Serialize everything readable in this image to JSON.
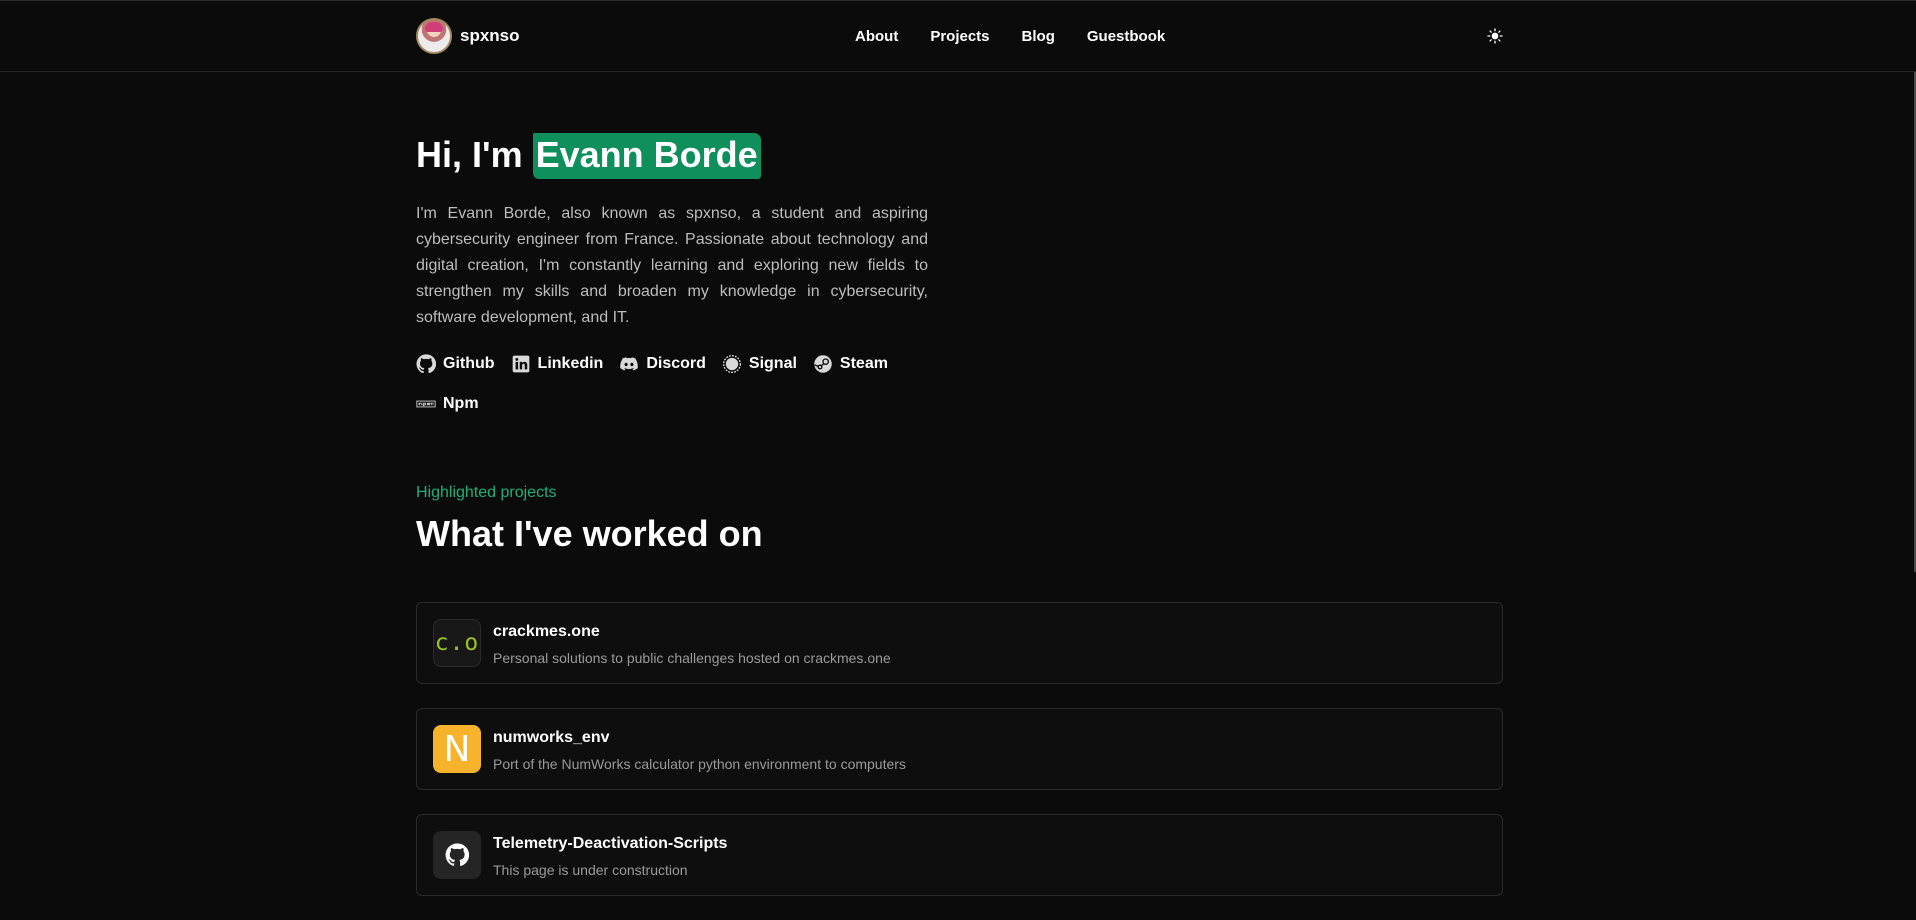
{
  "header": {
    "brand_name": "spxnso",
    "nav": [
      "About",
      "Projects",
      "Blog",
      "Guestbook"
    ],
    "theme_icon": "sun-icon"
  },
  "hero": {
    "greeting": "Hi, I'm",
    "name": "Evann Borde",
    "intro": "I'm Evann Borde, also known as spxnso, a student and aspiring cybersecurity engineer from France. Passionate about technology and digital creation, I'm constantly learning and exploring new fields to strengthen my skills and broaden my knowledge in cybersecurity, software development, and IT."
  },
  "socials": [
    {
      "label": "Github",
      "icon": "github-icon"
    },
    {
      "label": "Linkedin",
      "icon": "linkedin-icon"
    },
    {
      "label": "Discord",
      "icon": "discord-icon"
    },
    {
      "label": "Signal",
      "icon": "signal-icon"
    },
    {
      "label": "Steam",
      "icon": "steam-icon"
    },
    {
      "label": "Npm",
      "icon": "npm-icon"
    }
  ],
  "projects_section": {
    "kicker": "Highlighted projects",
    "title": "What I've worked on",
    "accent_color": "#1eb07a"
  },
  "projects": [
    {
      "name": "crackmes.one",
      "description": "Personal solutions to public challenges hosted on crackmes.one",
      "icon_text": "c.o"
    },
    {
      "name": "numworks_env",
      "description": "Port of the NumWorks calculator python environment to computers",
      "icon_text": "N"
    },
    {
      "name": "Telemetry-Deactivation-Scripts",
      "description": "This page is under construction",
      "icon": "github-icon"
    }
  ]
}
